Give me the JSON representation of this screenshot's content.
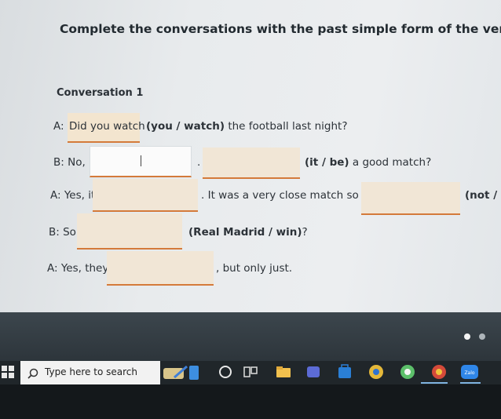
{
  "title": "Complete the conversations with the past simple form of the verb in",
  "conversation_label": "Conversation 1",
  "lines": {
    "l1": {
      "speaker": "A:",
      "answer": "Did you watch",
      "hint": "(you / watch)",
      "rest": "the football last night?"
    },
    "l2": {
      "speaker": "B: No, I",
      "period": ".",
      "hint": "(it / be)",
      "rest": "a good match?"
    },
    "l3": {
      "speaker": "A: Yes, it",
      "mid": ". It was a very close match so you",
      "hint": "(not / k"
    },
    "l4": {
      "speaker": "B: So",
      "hint": "(Real Madrid / win)",
      "end": "?"
    },
    "l5": {
      "speaker": "A: Yes, they",
      "rest": ", but only just."
    }
  },
  "taskbar": {
    "search_placeholder": "Type here to search",
    "icons": [
      "start-icon",
      "search-icon",
      "widget-icon",
      "cortana-icon",
      "task-view-icon",
      "file-explorer-icon",
      "teams-icon",
      "store-icon",
      "chrome-icon",
      "app-icon",
      "chrome-icon",
      "zalo-icon"
    ],
    "zalo_label": "Zalo"
  },
  "colors": {
    "answer_box": "#f1e6d6",
    "underline": "#d47a3a",
    "taskbar": "#20262a"
  }
}
